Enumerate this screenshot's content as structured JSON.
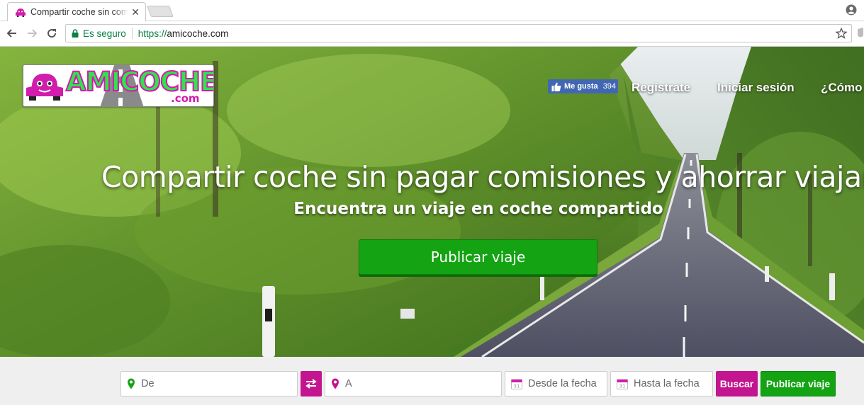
{
  "browser": {
    "tab_title": "Compartir coche sin comisiones",
    "secure_label": "Es seguro",
    "url_protocol": "https://",
    "url_host": "amicoche.com",
    "icons": [
      "back-arrow-icon",
      "forward-arrow-icon",
      "reload-icon",
      "lock-icon",
      "star-icon",
      "profile-icon",
      "close-icon"
    ]
  },
  "header": {
    "logo_text": "AMICOCHE",
    "logo_suffix": ".com",
    "fb_like_label": "Me gusta",
    "fb_like_count": "394",
    "nav": {
      "register": "Regístrate",
      "login": "Iniciar sesión",
      "how": "¿Cómo"
    }
  },
  "hero": {
    "title": "Compartir coche sin pagar comisiones y ahorrar viajando",
    "subtitle": "Encuentra un viaje en coche compartido",
    "cta_label": "Publicar viaje"
  },
  "search": {
    "from_placeholder": "De",
    "to_placeholder": "A",
    "date_from_placeholder": "Desde la fecha",
    "date_to_placeholder": "Hasta la fecha",
    "search_label": "Buscar",
    "publish_label": "Publicar viaje"
  },
  "colors": {
    "brand_magenta": "#c3158f",
    "brand_green": "#14a313",
    "secure_green": "#0b8043",
    "facebook_blue": "#4267b2"
  }
}
